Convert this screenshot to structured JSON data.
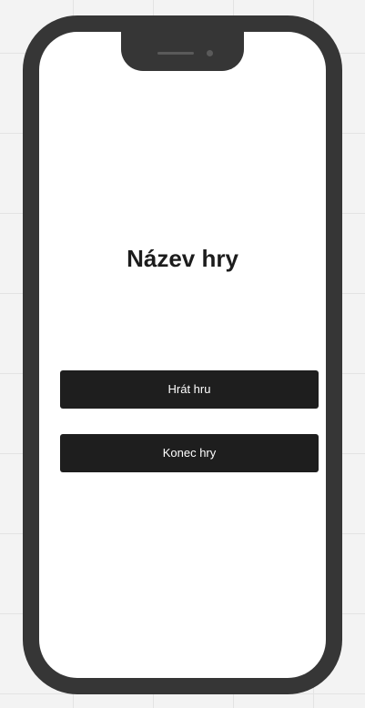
{
  "app": {
    "title": "Název hry"
  },
  "menu": {
    "play_label": "Hrát hru",
    "quit_label": "Konec hry"
  },
  "colors": {
    "device_frame": "#363636",
    "button_background": "#1e1e1e",
    "button_text": "#ffffff",
    "screen_background": "#ffffff",
    "title_text": "#1c1c1c"
  }
}
